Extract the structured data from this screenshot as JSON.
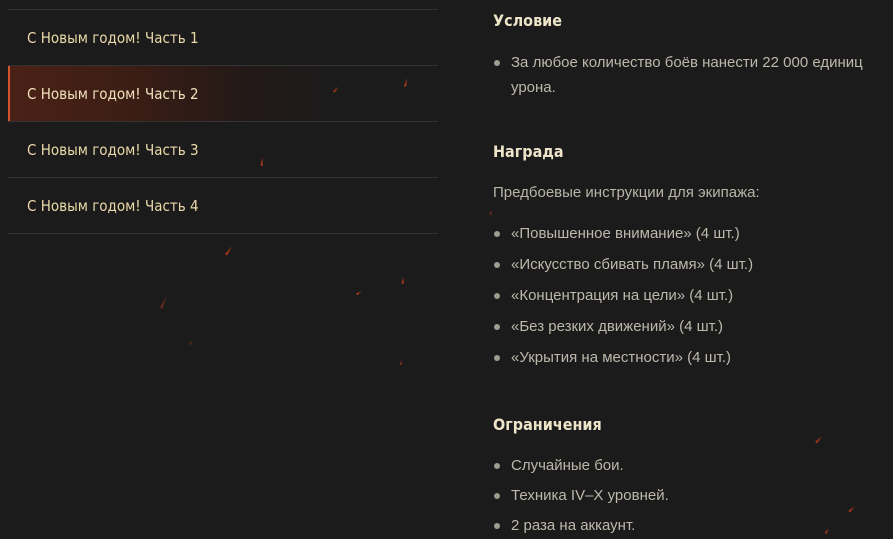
{
  "menu": {
    "items": [
      {
        "label": "С Новым годом! Часть 1",
        "active": false
      },
      {
        "label": "С Новым годом! Часть 2",
        "active": true
      },
      {
        "label": "С Новым годом! Часть 3",
        "active": false
      },
      {
        "label": "С Новым годом! Часть 4",
        "active": false
      }
    ]
  },
  "condition": {
    "title": "Условие",
    "items": [
      "За любое количество боёв нанести 22 000 единиц урона."
    ]
  },
  "reward": {
    "title": "Награда",
    "intro": "Предбоевые инструкции для экипажа:",
    "items": [
      "«Повышенное внимание» (4 шт.)",
      "«Искусство сбивать пламя» (4 шт.)",
      "«Концентрация на цели» (4 шт.)",
      "«Без резких движений» (4 шт.)",
      "«Укрытия на местности» (4 шт.)"
    ]
  },
  "limits": {
    "title": "Ограничения",
    "items": [
      "Случайные бои.",
      "Техника IV–X уровней.",
      "2 раза на аккаунт."
    ]
  },
  "colors": {
    "background": "#1b1b1c",
    "accent": "#d4532c",
    "menu_text": "#ebd9a8",
    "heading": "#ede4c9",
    "body_text": "#b8b4a8"
  }
}
